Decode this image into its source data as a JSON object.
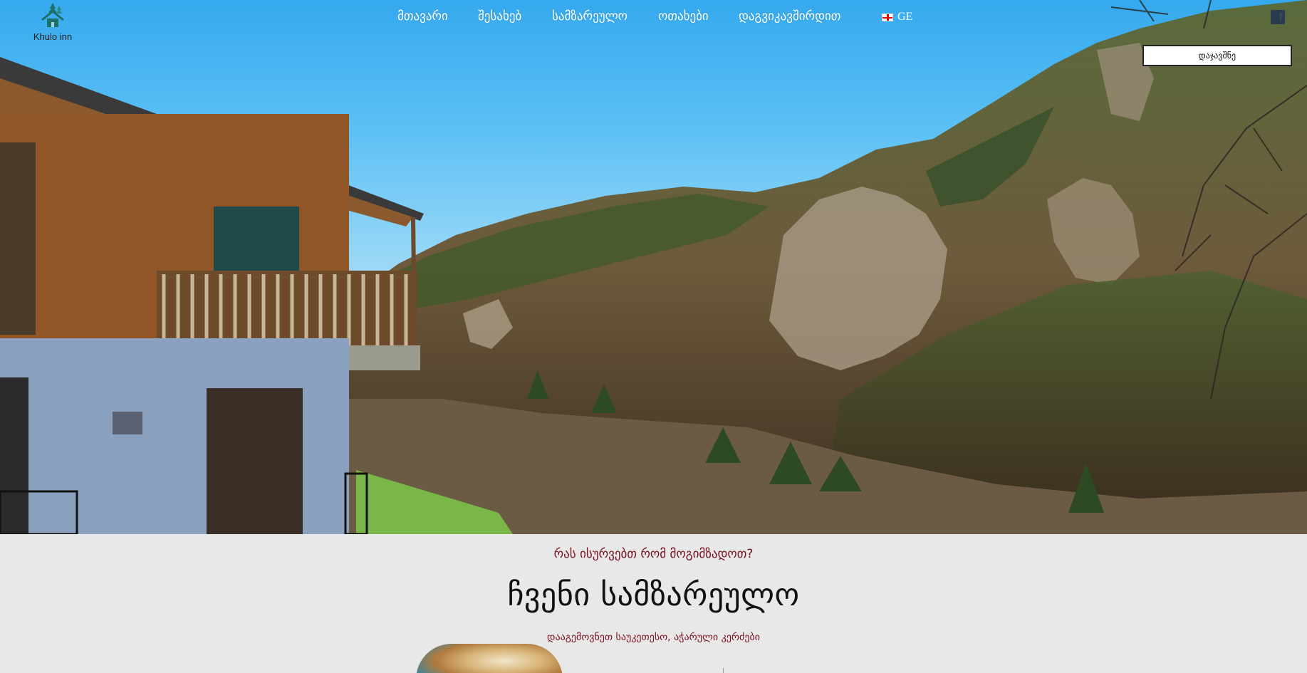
{
  "brand": {
    "logo_text": "Khulo inn"
  },
  "nav": {
    "items": [
      {
        "label": "მთავარი"
      },
      {
        "label": "შესახებ"
      },
      {
        "label": "სამზარეულო"
      },
      {
        "label": "ოთახები"
      },
      {
        "label": "დაგვიკავშირდით"
      }
    ],
    "language": "GE"
  },
  "social": {
    "icon": "facebook-icon",
    "glyph": "f"
  },
  "booking": {
    "button_label": "დაჯავშნე"
  },
  "hero": {
    "image": "mountain-valley-with-wooden-guesthouse"
  },
  "kitchen": {
    "kicker": "რას ისურვებთ რომ მოგიმზადოთ?",
    "title": "ჩვენი სამზარეულო",
    "subtitle": "დააგემოვნეთ საუკეთესო, აჭარული კერძები"
  },
  "colors": {
    "accent": "#7a1020",
    "sky": "#35a9ee",
    "section_bg": "#e8e8e8"
  }
}
